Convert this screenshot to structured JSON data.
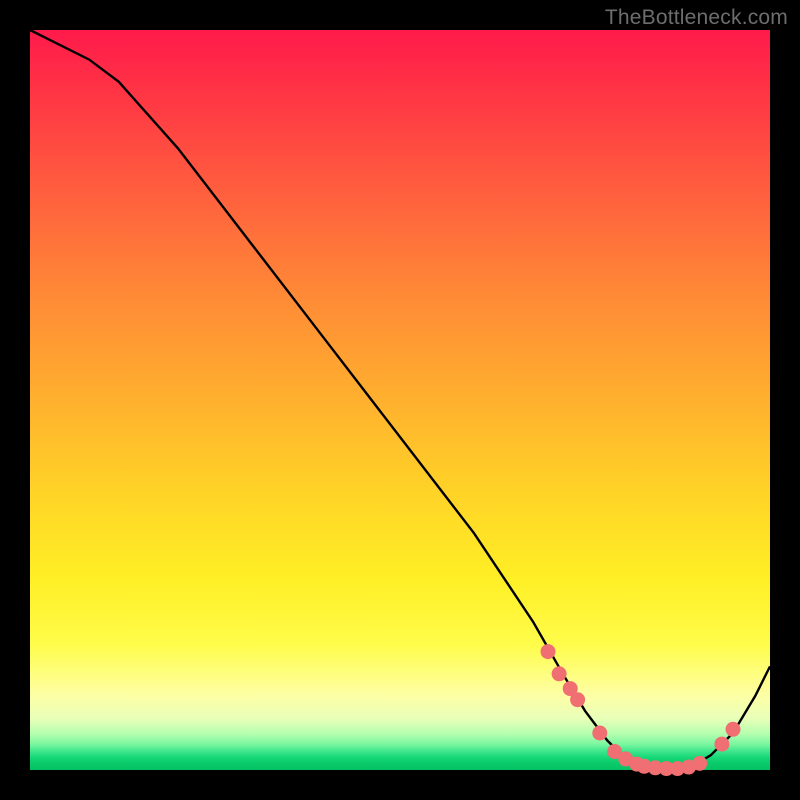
{
  "watermark": "TheBottleneck.com",
  "colors": {
    "curve_stroke": "#000000",
    "marker_fill": "#ef6f72",
    "marker_stroke": "#ef6f72"
  },
  "chart_data": {
    "type": "line",
    "title": "",
    "xlabel": "",
    "ylabel": "",
    "xlim": [
      0,
      100
    ],
    "ylim": [
      0,
      100
    ],
    "series": [
      {
        "name": "bottleneck-curve",
        "x": [
          0,
          4,
          8,
          12,
          20,
          30,
          40,
          50,
          60,
          68,
          72,
          75,
          78,
          80,
          82,
          84,
          86,
          88,
          90,
          92,
          95,
          98,
          100
        ],
        "y": [
          100,
          98,
          96,
          93,
          84,
          71,
          58,
          45,
          32,
          20,
          13,
          8,
          4,
          2,
          0.8,
          0.3,
          0.1,
          0.2,
          0.8,
          2,
          5,
          10,
          14
        ]
      }
    ],
    "markers": {
      "name": "highlight-points",
      "x": [
        70,
        71.5,
        73,
        74,
        77,
        79,
        80.5,
        82,
        83,
        84.5,
        86,
        87.5,
        89,
        90.5,
        93.5,
        95
      ],
      "y": [
        16,
        13,
        11,
        9.5,
        5,
        2.5,
        1.5,
        0.8,
        0.5,
        0.3,
        0.2,
        0.2,
        0.4,
        0.9,
        3.5,
        5.5
      ]
    }
  }
}
